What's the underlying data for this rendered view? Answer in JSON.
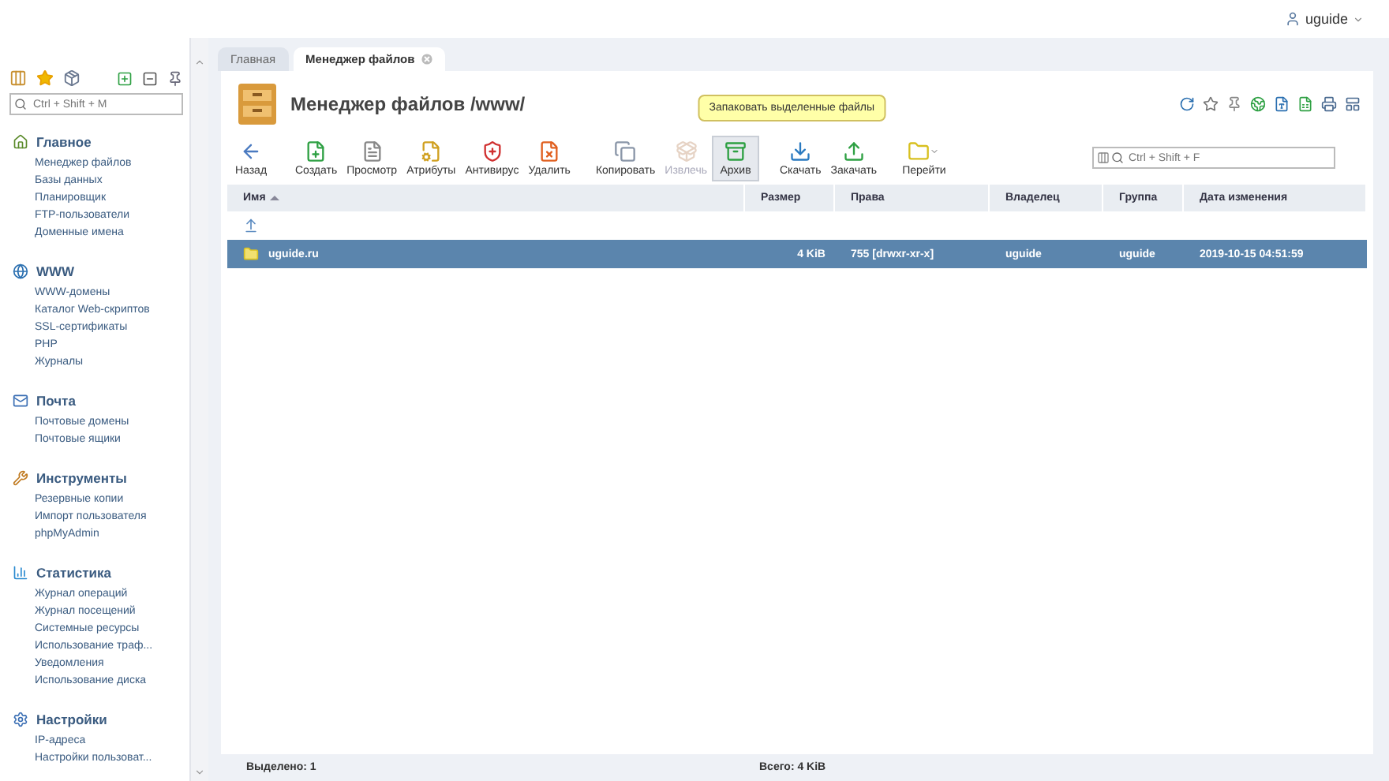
{
  "user": {
    "name": "uguide"
  },
  "sidebar": {
    "search": {
      "placeholder": "Ctrl + Shift + M"
    },
    "sections": [
      {
        "title": "Главное",
        "items": [
          "Менеджер файлов",
          "Базы данных",
          "Планировщик",
          "FTP-пользователи",
          "Доменные имена"
        ]
      },
      {
        "title": "WWW",
        "items": [
          "WWW-домены",
          "Каталог Web-скриптов",
          "SSL-сертификаты",
          "PHP",
          "Журналы"
        ]
      },
      {
        "title": "Почта",
        "items": [
          "Почтовые домены",
          "Почтовые ящики"
        ]
      },
      {
        "title": "Инструменты",
        "items": [
          "Резервные копии",
          "Импорт пользователя",
          "phpMyAdmin"
        ]
      },
      {
        "title": "Статистика",
        "items": [
          "Журнал операций",
          "Журнал посещений",
          "Системные ресурсы",
          "Использование траф...",
          "Уведомления",
          "Использование диска"
        ]
      },
      {
        "title": "Настройки",
        "items": [
          "IP-адреса",
          "Настройки пользоват..."
        ]
      }
    ]
  },
  "tabs": [
    {
      "label": "Главная",
      "selected": false,
      "closable": false
    },
    {
      "label": "Менеджер файлов",
      "selected": true,
      "closable": true
    }
  ],
  "page": {
    "title": "Менеджер файлов /www/"
  },
  "toolbar": {
    "groups": [
      [
        {
          "label": "Назад",
          "disabled": false,
          "hovered": false
        }
      ],
      [
        {
          "label": "Создать",
          "disabled": false,
          "hovered": false
        },
        {
          "label": "Просмотр",
          "disabled": false,
          "hovered": false
        },
        {
          "label": "Атрибуты",
          "disabled": false,
          "hovered": false
        },
        {
          "label": "Антивирус",
          "disabled": false,
          "hovered": false
        },
        {
          "label": "Удалить",
          "disabled": false,
          "hovered": false
        }
      ],
      [
        {
          "label": "Копировать",
          "disabled": false,
          "hovered": false
        },
        {
          "label": "Извлечь",
          "disabled": true,
          "hovered": false
        },
        {
          "label": "Архив",
          "disabled": false,
          "hovered": true,
          "tooltip": "Запаковать выделенные файлы"
        }
      ],
      [
        {
          "label": "Скачать",
          "disabled": false,
          "hovered": false
        },
        {
          "label": "Закачать",
          "disabled": false,
          "hovered": false
        }
      ],
      [
        {
          "label": "Перейти",
          "disabled": false,
          "hovered": false,
          "dropdown": true
        }
      ]
    ],
    "filter": {
      "placeholder": "Ctrl + Shift + F"
    }
  },
  "table": {
    "columns": [
      {
        "label": "Имя",
        "sorted": true
      },
      {
        "label": "Размер",
        "sorted": false
      },
      {
        "label": "Права",
        "sorted": false
      },
      {
        "label": "Владелец",
        "sorted": false
      },
      {
        "label": "Группа",
        "sorted": false
      },
      {
        "label": "Дата изменения",
        "sorted": false
      }
    ],
    "rows": [
      {
        "kind": "parent",
        "selected": false
      },
      {
        "kind": "folder",
        "selected": true,
        "cells": [
          "uguide.ru",
          "4 KiB",
          "755 [drwxr-xr-x]",
          "uguide",
          "uguide",
          "2019-10-15 04:51:59"
        ]
      }
    ]
  },
  "status_bar": {
    "selected": "Выделено: 1",
    "total": "Всего: 4 KiB"
  }
}
